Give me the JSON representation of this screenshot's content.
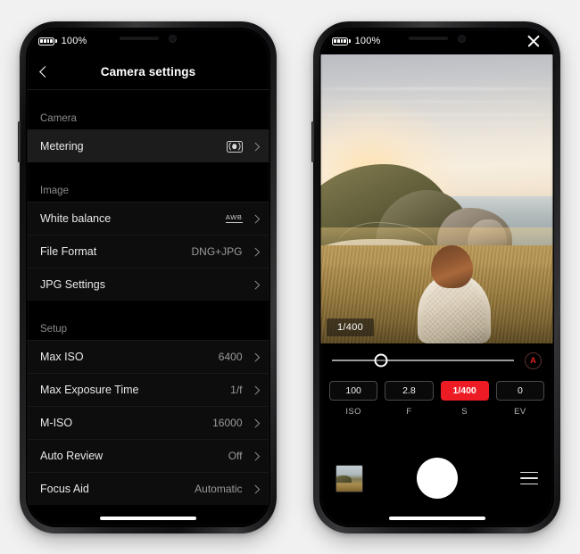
{
  "background_color": "#f1f1f1",
  "accent_color": "#ed1c24",
  "phones": {
    "left": {
      "name": "camera-settings-phone",
      "status_bar": {
        "battery_icon": "battery-full-icon",
        "battery_text": "100%"
      },
      "nav": {
        "back_icon": "chevron-left-icon",
        "title": "Camera settings"
      },
      "sections": [
        {
          "header": "Camera",
          "rows": [
            {
              "label": "Metering",
              "value": "",
              "icon": "metering-mode-icon",
              "highlighted": true,
              "chevron": "chevron-right-icon"
            }
          ]
        },
        {
          "header": "Image",
          "rows": [
            {
              "label": "White balance",
              "value": "",
              "icon": "awb-icon",
              "icon_text": "AWB",
              "highlighted": false,
              "chevron": "chevron-right-icon"
            },
            {
              "label": "File Format",
              "value": "DNG+JPG",
              "icon": "",
              "highlighted": false,
              "chevron": "chevron-right-icon"
            },
            {
              "label": "JPG Settings",
              "value": "",
              "icon": "",
              "highlighted": false,
              "chevron": "chevron-right-icon"
            }
          ]
        },
        {
          "header": "Setup",
          "rows": [
            {
              "label": "Max ISO",
              "value": "6400",
              "icon": "",
              "highlighted": false,
              "chevron": "chevron-right-icon"
            },
            {
              "label": "Max Exposure Time",
              "value": "1/f",
              "icon": "",
              "highlighted": false,
              "chevron": "chevron-right-icon"
            },
            {
              "label": "M-ISO",
              "value": "16000",
              "icon": "",
              "highlighted": false,
              "chevron": "chevron-right-icon"
            },
            {
              "label": "Auto Review",
              "value": "Off",
              "icon": "",
              "highlighted": false,
              "chevron": "chevron-right-icon"
            },
            {
              "label": "Focus Aid",
              "value": "Automatic",
              "icon": "",
              "highlighted": false,
              "chevron": "chevron-right-icon"
            }
          ]
        }
      ]
    },
    "right": {
      "name": "camera-viewfinder-phone",
      "status_bar": {
        "battery_icon": "battery-full-icon",
        "battery_text": "100%",
        "close_icon": "close-icon"
      },
      "viewfinder": {
        "scene_description": "coastal cliffs at sunset with a person sitting in tall grass",
        "shutter_badge": "1/400"
      },
      "slider": {
        "name": "exposure-slider",
        "thumb_position_percent": 27,
        "auto_badge": "A"
      },
      "exposure_controls": [
        {
          "value": "100",
          "label": "ISO",
          "active": false
        },
        {
          "value": "2.8",
          "label": "F",
          "active": false
        },
        {
          "value": "1/400",
          "label": "S",
          "active": true
        },
        {
          "value": "0",
          "label": "EV",
          "active": false
        }
      ],
      "bottom_bar": {
        "gallery_icon": "gallery-thumbnail-icon",
        "shutter_icon": "shutter-button-icon",
        "menu_icon": "hamburger-menu-icon"
      }
    }
  }
}
